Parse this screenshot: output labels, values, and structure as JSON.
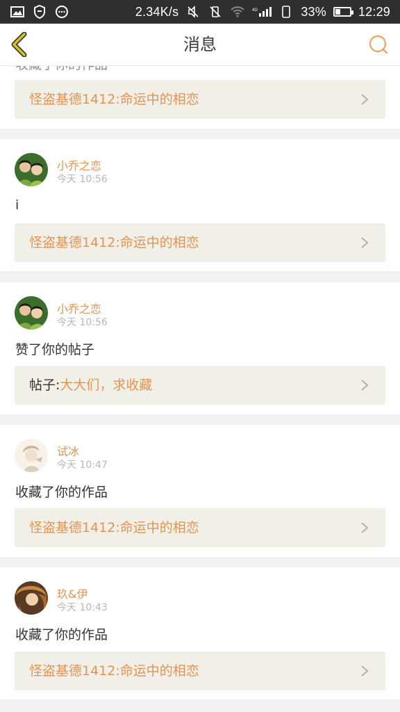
{
  "status_bar": {
    "speed": "2.34K/s",
    "battery": "33%",
    "battery_level": 0.33,
    "time": "12:29",
    "network_label": "4G"
  },
  "header": {
    "title": "消息",
    "back_icon": "chevron-left-icon",
    "search_icon": "search-icon"
  },
  "colors": {
    "accent": "#e69251",
    "back_icon": "#c9b41a",
    "link_bg": "#f0f0e8"
  },
  "messages": [
    {
      "partial_text": "收藏了你的作品",
      "link_prefix": "",
      "link_title": "怪盗基德1412:命运中的相恋"
    },
    {
      "user": "小乔之恋",
      "time": "今天 10:56",
      "text": "i",
      "link_prefix": "",
      "link_title": "怪盗基德1412:命运中的相恋"
    },
    {
      "user": "小乔之恋",
      "time": "今天 10:56",
      "text": "赞了你的帖子",
      "link_prefix": "帖子:",
      "link_title": "大大们，求收藏"
    },
    {
      "user": "试冰",
      "time": "今天 10:47",
      "text": "收藏了你的作品",
      "link_prefix": "",
      "link_title": "怪盗基德1412:命运中的相恋"
    },
    {
      "user": "玖&伊",
      "time": "今天 10:43",
      "text": "收藏了你的作品",
      "link_prefix": "",
      "link_title": "怪盗基德1412:命运中的相恋"
    }
  ]
}
